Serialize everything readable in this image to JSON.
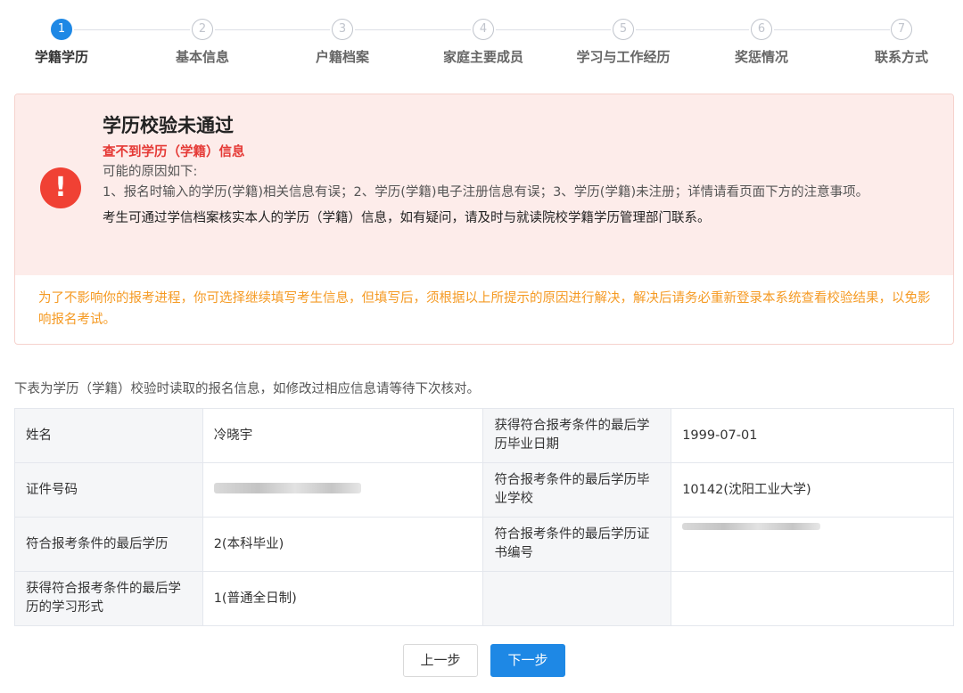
{
  "steps": [
    {
      "num": "1",
      "label": "学籍学历",
      "active": true
    },
    {
      "num": "2",
      "label": "基本信息",
      "active": false
    },
    {
      "num": "3",
      "label": "户籍档案",
      "active": false
    },
    {
      "num": "4",
      "label": "家庭主要成员",
      "active": false
    },
    {
      "num": "5",
      "label": "学习与工作经历",
      "active": false
    },
    {
      "num": "6",
      "label": "奖惩情况",
      "active": false
    },
    {
      "num": "7",
      "label": "联系方式",
      "active": false
    }
  ],
  "alert": {
    "icon": "exclamation-icon",
    "icon_glyph": "!",
    "title": "学历校验未通过",
    "subtitle": "查不到学历（学籍）信息",
    "reasons_intro": "可能的原因如下:",
    "reasons": "1、报名时输入的学历(学籍)相关信息有误；2、学历(学籍)电子注册信息有误；3、学历(学籍)未注册；详情请看页面下方的注意事项。",
    "note": "考生可通过学信档案核实本人的学历（学籍）信息，如有疑问，请及时与就读院校学籍学历管理部门联系。",
    "warning": "为了不影响你的报考进程，你可选择继续填写考生信息，但填写后，须根据以上所提示的原因进行解决，解决后请务必重新登录本系统查看校验结果，以免影响报名考试。"
  },
  "info": {
    "caption": "下表为学历（学籍）校验时读取的报名信息，如修改过相应信息请等待下次核对。",
    "rows": [
      {
        "k1": "姓名",
        "v1": "冷晓宇",
        "k2": "获得符合报考条件的最后学历毕业日期",
        "v2": "1999-07-01"
      },
      {
        "k1": "证件号码",
        "v1": "",
        "k2": "符合报考条件的最后学历毕业学校",
        "v2": "10142(沈阳工业大学)"
      },
      {
        "k1": "符合报考条件的最后学历",
        "v1": "2(本科毕业)",
        "k2": "符合报考条件的最后学历证书编号",
        "v2": ""
      },
      {
        "k1": "获得符合报考条件的最后学历的学习形式",
        "v1": "1(普通全日制)",
        "k2": "",
        "v2": ""
      }
    ]
  },
  "buttons": {
    "prev": "上一步",
    "next": "下一步"
  },
  "colors": {
    "accent": "#1e88e5",
    "error": "#f04134",
    "warning_text": "#f59a23",
    "alert_bg": "#fdecea"
  }
}
